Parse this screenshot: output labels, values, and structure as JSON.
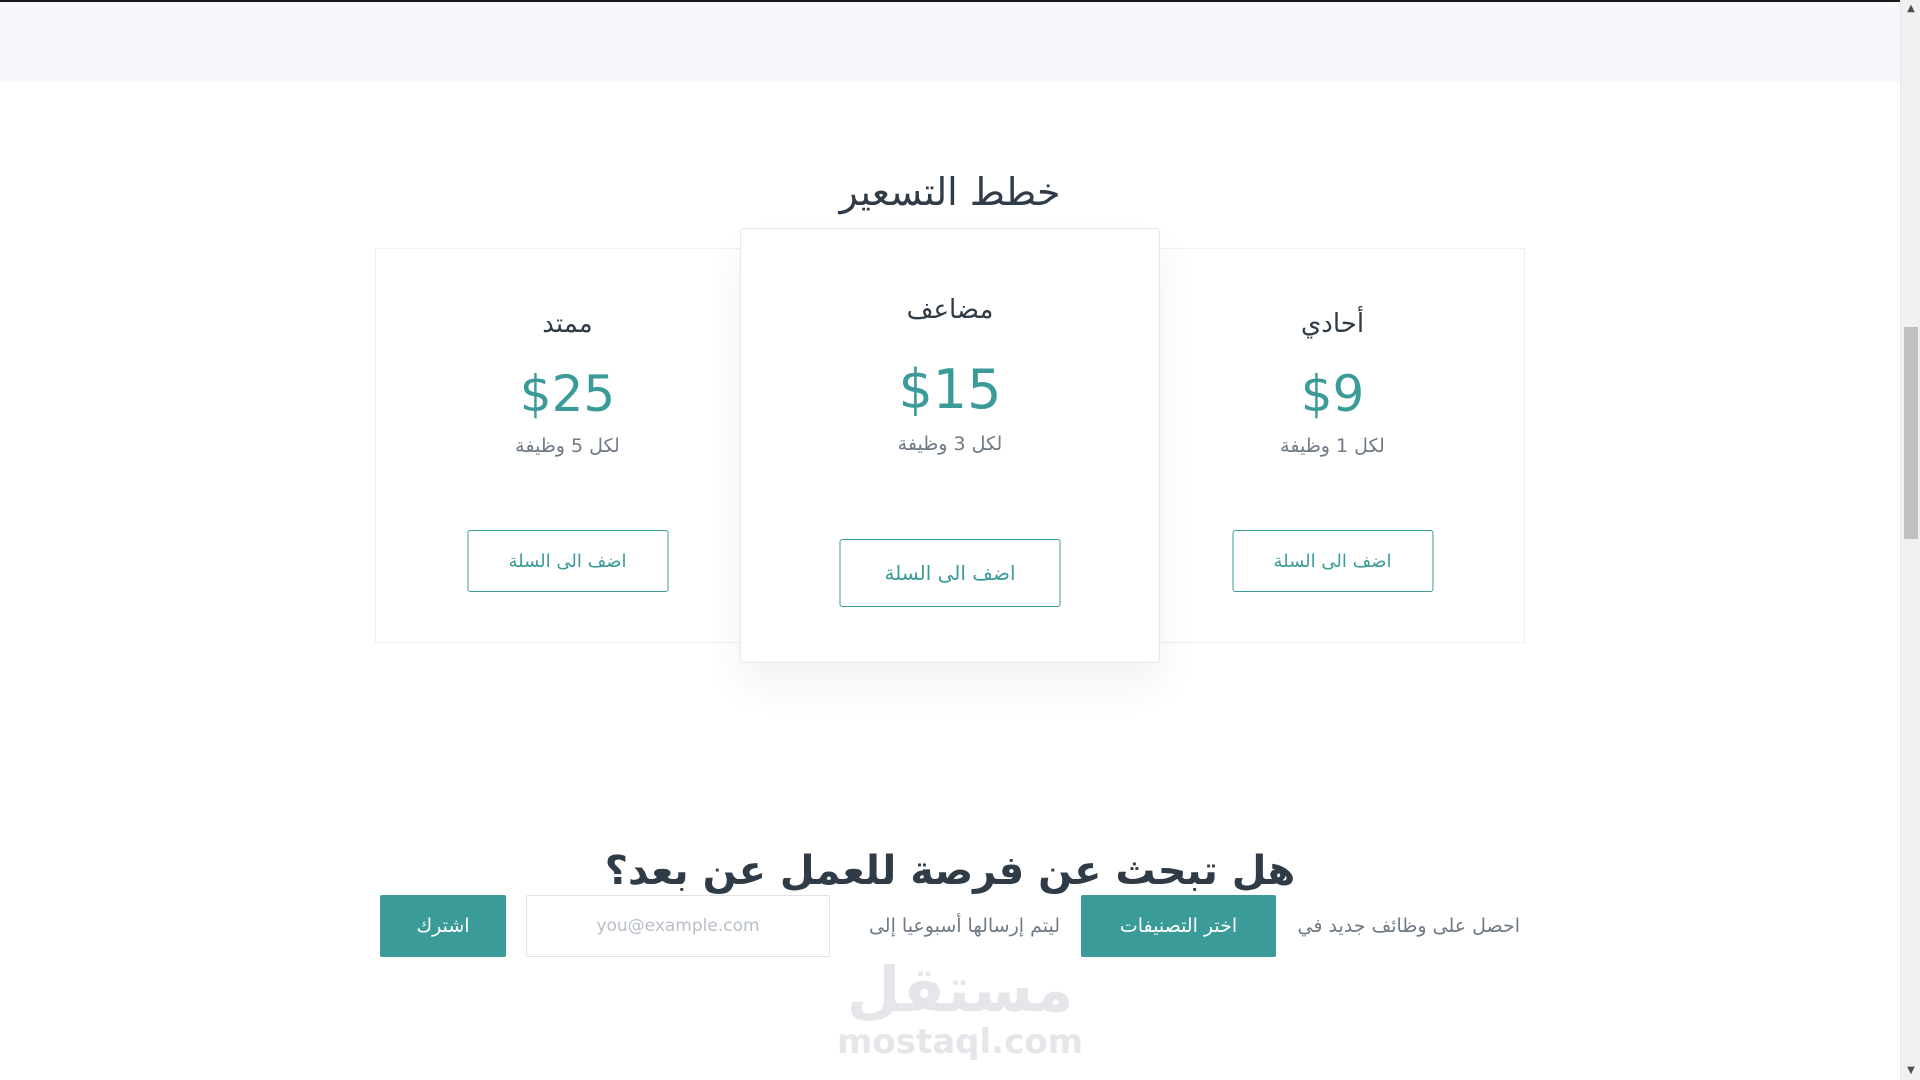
{
  "pricing": {
    "title": "خطط التسعير",
    "plans": [
      {
        "name": "أحادي",
        "price": "$9",
        "per": "لكل 1 وظيفة",
        "button": "اضف الى السلة"
      },
      {
        "name": "مضاعف",
        "price": "$15",
        "per": "لكل 3 وظيفة",
        "button": "اضف الى السلة"
      },
      {
        "name": "ممتد",
        "price": "$25",
        "per": "لكل 5 وظيفة",
        "button": "اضف الى السلة"
      }
    ]
  },
  "subscribe": {
    "question": "هل تبحث عن فرصة للعمل عن بعد؟",
    "text_before": "احصل على وظائف جديد في",
    "categories_button": "اختر التصنيفات",
    "text_after": "ليتم إرسالها أسبوعيا إلى",
    "email_placeholder": "you@example.com",
    "subscribe_button": "اشترك"
  },
  "watermark": {
    "arabic": "مستقل",
    "latin": "mostaql.com"
  },
  "colors": {
    "accent": "#3b9b99",
    "heading": "#2f3b46",
    "muted": "#6f7a86",
    "band": "#f7f8fc"
  },
  "icons": {
    "scroll_up": "caret-up-icon",
    "scroll_down": "caret-down-icon"
  }
}
